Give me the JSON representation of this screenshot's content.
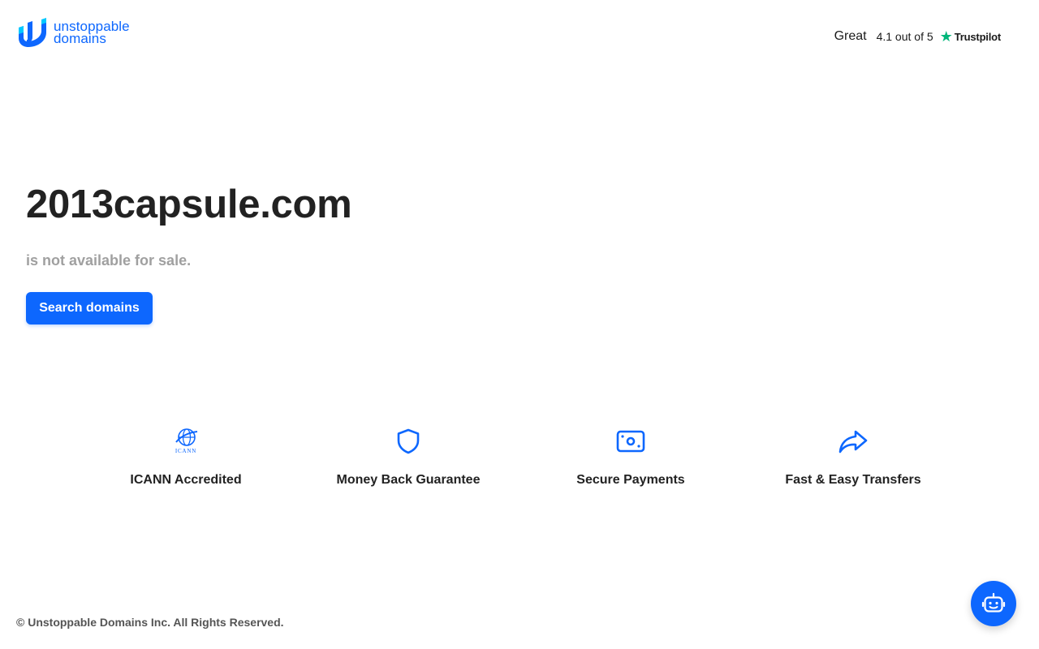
{
  "header": {
    "logo": {
      "line1": "unstoppable",
      "line2": "domains"
    },
    "trustpilot": {
      "rating_word": "Great",
      "score_text": "4.1 out of 5",
      "brand": "Trustpilot",
      "star_glyph": "★",
      "star_color": "#00b67a"
    }
  },
  "hero": {
    "domain": "2013capsule.com",
    "status": "is not available for sale.",
    "search_button": "Search domains"
  },
  "features": [
    {
      "icon": "icann-logo-icon",
      "label": "ICANN Accredited",
      "icon_text": "ICANN"
    },
    {
      "icon": "shield-icon",
      "label": "Money Back Guarantee"
    },
    {
      "icon": "payment-card-icon",
      "label": "Secure Payments"
    },
    {
      "icon": "share-arrow-icon",
      "label": "Fast & Easy Transfers"
    }
  ],
  "footer": {
    "copyright": "© Unstoppable Domains Inc. All Rights Reserved.",
    "chat_icon": "chatbot-icon"
  },
  "colors": {
    "brand_blue": "#0d67fe",
    "text_dark": "#222222",
    "text_muted": "#a0a0a0",
    "trustpilot_green": "#00b67a"
  }
}
